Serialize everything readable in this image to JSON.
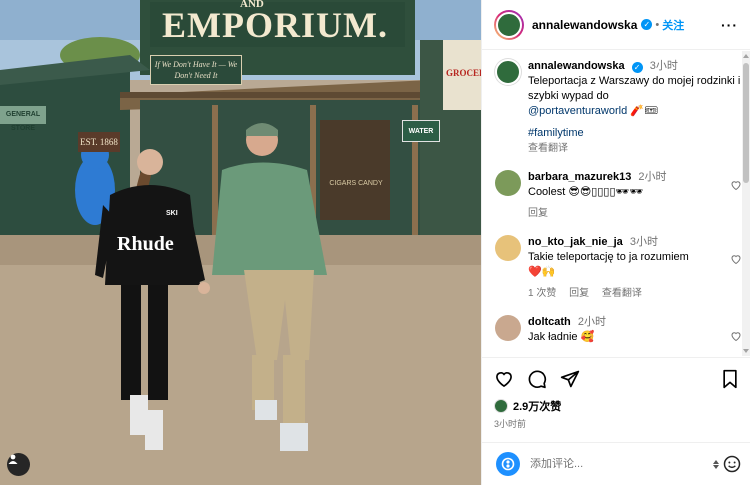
{
  "photo": {
    "sign_top": "EMPORIUM.",
    "sign_top_small": "AND",
    "sign_small": "If We Don't Have It — We Don't Need It",
    "est_sign": "EST. 1868",
    "left_store": "GENERAL STORE",
    "depot_sign": "WATER",
    "right_poster": "GROCER",
    "shirt_text": "Rhude",
    "shirt_small": "SKI",
    "cigars": "CIGARS CANDY"
  },
  "header": {
    "username": "annalewandowska",
    "dot": "•",
    "follow_label": "关注",
    "more_label": "···"
  },
  "caption": {
    "username": "annalewandowska",
    "time": "3小时",
    "text": "Teleportacja z Warszawy do mojej rodzinki i szybki wypad do",
    "mention": "@portaventuraworld",
    "emoji": "🧨🎟",
    "hashtag": "#familytime",
    "translate": "查看翻译"
  },
  "comments": [
    {
      "username": "barbara_mazurek13",
      "time": "2小时",
      "text": "Coolest 😎😎▯▯▯▯🕶🕶",
      "reply": "回复"
    },
    {
      "username": "no_kto_jak_nie_ja",
      "time": "3小时",
      "text": "Takie teleportację to ja rozumiem",
      "emoji": "❤️🙌",
      "likes": "1 次赞",
      "reply": "回复",
      "translate": "查看翻译"
    },
    {
      "username": "doltcath",
      "time": "2小时",
      "text": "Jak ładnie 🥰"
    }
  ],
  "actions": {
    "likes": "2.9万次赞",
    "time": "3小时前"
  },
  "add_comment": {
    "placeholder": "添加评论..."
  },
  "colors": {
    "accent": "#0095f6",
    "link": "#00376b",
    "muted": "#737373"
  }
}
